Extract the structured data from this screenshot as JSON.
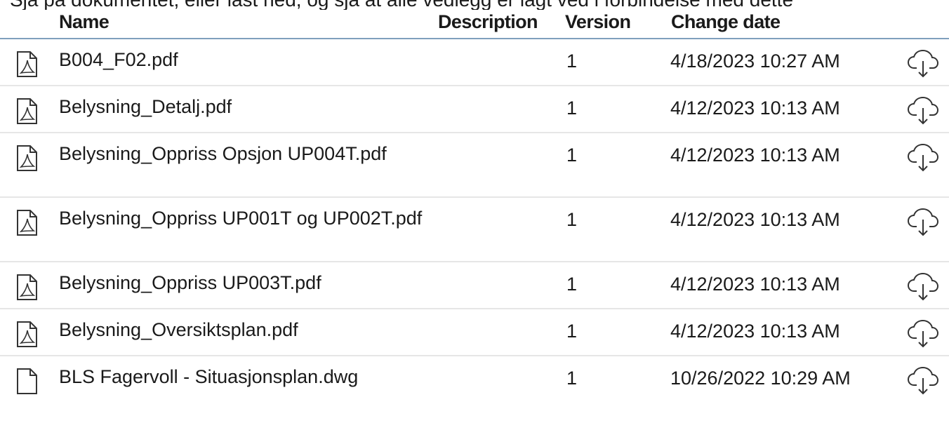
{
  "header": {
    "top_cut_text": "Sjå på dokumentet, eller last ned, og sjå at alle vedlegg er lagt ved i forbindelse med dette",
    "name_label": "Name",
    "description_label": "Description",
    "version_label": "Version",
    "change_date_label": "Change date"
  },
  "files": [
    {
      "name": "B004_F02.pdf",
      "version": "1",
      "change_date": "4/18/2023 10:27 AM",
      "icon": "pdf-file-icon"
    },
    {
      "name": "Belysning_Detalj.pdf",
      "version": "1",
      "change_date": "4/12/2023 10:13 AM",
      "icon": "pdf-file-icon"
    },
    {
      "name": "Belysning_Oppriss Opsjon UP004T.pdf",
      "version": "1",
      "change_date": "4/12/2023 10:13 AM",
      "icon": "pdf-file-icon"
    },
    {
      "name": "Belysning_Oppriss UP001T og UP002T.pdf",
      "version": "1",
      "change_date": "4/12/2023 10:13 AM",
      "icon": "pdf-file-icon"
    },
    {
      "name": "Belysning_Oppriss UP003T.pdf",
      "version": "1",
      "change_date": "4/12/2023 10:13 AM",
      "icon": "pdf-file-icon"
    },
    {
      "name": "Belysning_Oversiktsplan.pdf",
      "version": "1",
      "change_date": "4/12/2023 10:13 AM",
      "icon": "pdf-file-icon"
    },
    {
      "name": "BLS Fagervoll - Situasjonsplan.dwg",
      "version": "1",
      "change_date": "10/26/2022 10:29 AM",
      "icon": "generic-file-icon"
    }
  ],
  "download_icon": "cloud-download-icon",
  "colors": {
    "header_rule": "#7f9fbd",
    "row_divider": "#e6e6e6",
    "text": "#1a1a1a"
  }
}
